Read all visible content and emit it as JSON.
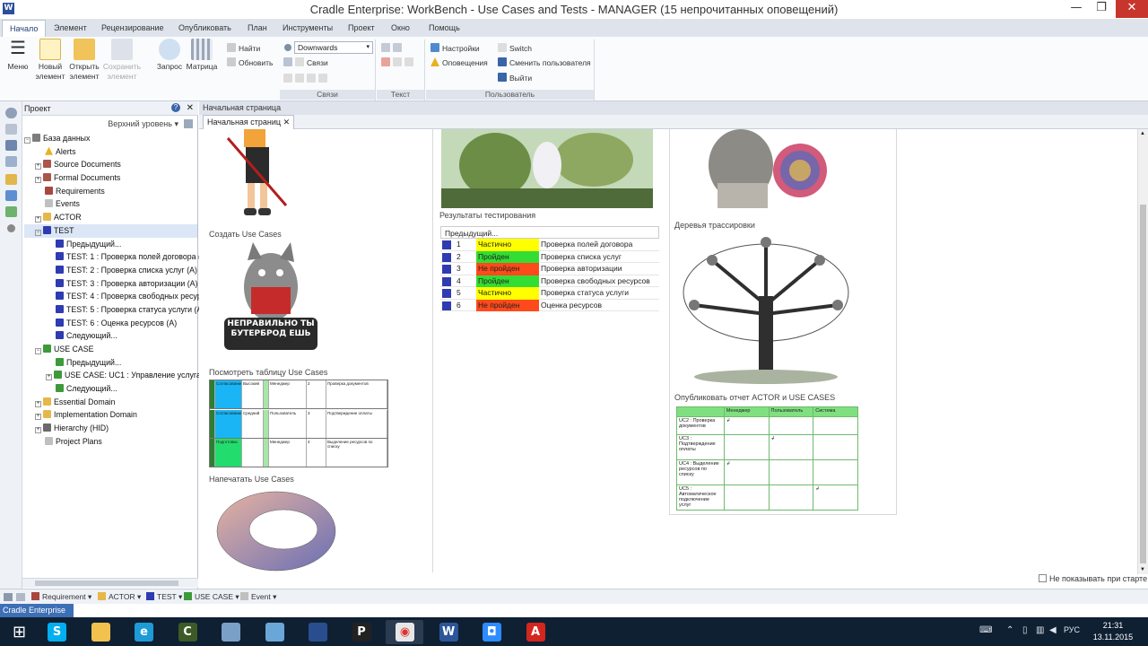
{
  "window": {
    "title": "Cradle Enterprise: WorkBench - Use Cases and Tests - MANAGER (15 непрочитанных оповещений)",
    "minimize": "—",
    "maximize": "❐",
    "close": "✕"
  },
  "menu": [
    "Начало",
    "Элемент",
    "Рецензирование",
    "Опубликовать",
    "План",
    "Инструменты",
    "Проект",
    "Окно",
    "Помощь"
  ],
  "ribbon": {
    "menu_label": "Меню",
    "new_label": "Новый элемент",
    "open_label": "Открыть элемент",
    "save_label": "Сохранить элемент",
    "query_label": "Запрос",
    "matrix_label": "Матрица",
    "find_label": "Найти",
    "refresh_label": "Обновить",
    "direction_value": "Downwards",
    "links_small": "Связи",
    "group_links": "Связи",
    "group_text": "Текст",
    "settings_label": "Настройки",
    "alerts_label": "Оповещения",
    "switch_label": "Switch",
    "change_user_label": "Сменить пользователя",
    "exit_label": "Выйти",
    "group_user": "Пользователь"
  },
  "left_panel": {
    "title": "Проект",
    "level": "Верхний уровень",
    "tree": [
      {
        "label": "База данных",
        "indent": 0,
        "icon": "ic-db",
        "exp": "−"
      },
      {
        "label": "Alerts",
        "indent": 1,
        "icon": "ic-warn",
        "exp": ""
      },
      {
        "label": "Source Documents",
        "indent": 1,
        "icon": "ic-doc",
        "exp": "+"
      },
      {
        "label": "Formal Documents",
        "indent": 1,
        "icon": "ic-doc",
        "exp": "+"
      },
      {
        "label": "Requirements",
        "indent": 1,
        "icon": "ic-req",
        "exp": ""
      },
      {
        "label": "Events",
        "indent": 1,
        "icon": "ic-plan",
        "exp": ""
      },
      {
        "label": "ACTOR",
        "indent": 1,
        "icon": "ic-folder",
        "exp": "+"
      },
      {
        "label": "TEST",
        "indent": 1,
        "icon": "ic-blue",
        "exp": "−"
      },
      {
        "label": "Предыдущий...",
        "indent": 2,
        "icon": "ic-blue",
        "exp": ""
      },
      {
        "label": "TEST: 1 : Проверка полей договора (A",
        "indent": 2,
        "icon": "ic-blue",
        "exp": ""
      },
      {
        "label": "TEST: 2 : Проверка списка услуг (A)",
        "indent": 2,
        "icon": "ic-blue",
        "exp": ""
      },
      {
        "label": "TEST: 3 : Проверка авторизации (A)",
        "indent": 2,
        "icon": "ic-blue",
        "exp": ""
      },
      {
        "label": "TEST: 4 : Проверка свободных ресурс",
        "indent": 2,
        "icon": "ic-blue",
        "exp": ""
      },
      {
        "label": "TEST: 5 : Проверка статуса услуги (A)",
        "indent": 2,
        "icon": "ic-blue",
        "exp": ""
      },
      {
        "label": "TEST: 6 : Оценка ресурсов (A)",
        "indent": 2,
        "icon": "ic-blue",
        "exp": ""
      },
      {
        "label": "Следующий...",
        "indent": 2,
        "icon": "ic-blue",
        "exp": ""
      },
      {
        "label": "USE CASE",
        "indent": 1,
        "icon": "ic-green",
        "exp": "−"
      },
      {
        "label": "Предыдущий...",
        "indent": 2,
        "icon": "ic-green",
        "exp": ""
      },
      {
        "label": "USE CASE: UC1 : Управление услугами",
        "indent": 2,
        "icon": "ic-green",
        "exp": "+"
      },
      {
        "label": "Следующий...",
        "indent": 2,
        "icon": "ic-green",
        "exp": ""
      },
      {
        "label": "Essential Domain",
        "indent": 1,
        "icon": "ic-folder",
        "exp": "+"
      },
      {
        "label": "Implementation Domain",
        "indent": 1,
        "icon": "ic-folder",
        "exp": "+"
      },
      {
        "label": "Hierarchy (HID)",
        "indent": 1,
        "icon": "ic-tree",
        "exp": "+"
      },
      {
        "label": "Project Plans",
        "indent": 1,
        "icon": "ic-plan",
        "exp": ""
      }
    ]
  },
  "doc": {
    "strip_title": "Начальная страница",
    "tab_label": "Начальная страниц",
    "captions": {
      "create": "Создать Use Cases",
      "view_table": "Посмотреть таблицу Use Cases",
      "print": "Напечатать Use Cases",
      "results": "Результаты тестирования",
      "trees": "Деревья трассировки",
      "publish": "Опубликовать отчет ACTOR и USE CASES"
    },
    "logo_text": "НЕПРАВИЛЬНО ТЫ БУТЕРБРОД ЕШЬ"
  },
  "results": {
    "header": "Предыдущий...",
    "rows": [
      {
        "num": "1",
        "status": "Частично",
        "status_color": "#ffff00",
        "name": "Проверка полей договора"
      },
      {
        "num": "2",
        "status": "Пройден",
        "status_color": "#33dd33",
        "name": "Проверка списка услуг"
      },
      {
        "num": "3",
        "status": "Не пройден",
        "status_color": "#ff4a1c",
        "name": "Проверка авторизации"
      },
      {
        "num": "4",
        "status": "Пройден",
        "status_color": "#33dd33",
        "name": "Проверка свободных ресурсов"
      },
      {
        "num": "5",
        "status": "Частично",
        "status_color": "#ffff00",
        "name": "Проверка статуса услуги"
      },
      {
        "num": "6",
        "status": "Не пройден",
        "status_color": "#ff4a1c",
        "name": "Оценка ресурсов"
      }
    ]
  },
  "matrix": {
    "headers": [
      "",
      "Менеджер",
      "Пользователь",
      "Система"
    ],
    "rows": [
      {
        "label": "UC2 : Проверка документов",
        "cells": [
          "↲",
          "",
          ""
        ]
      },
      {
        "label": "UC3 : Подтверждение оплаты",
        "cells": [
          "",
          "↲",
          ""
        ]
      },
      {
        "label": "UC4 : Выделение ресурсов по списку",
        "cells": [
          "↲",
          "",
          ""
        ]
      },
      {
        "label": "UC5 : Автоматическое подключение услуг",
        "cells": [
          "",
          "",
          "↲"
        ]
      }
    ]
  },
  "uc_table": {
    "rows": [
      {
        "a": "Согласование",
        "b": "Высокий",
        "c": "Менеджер",
        "d": "2",
        "e": "Проверка документов",
        "color": "#19b5f5"
      },
      {
        "a": "Согласование",
        "b": "Средний",
        "c": "Пользователь",
        "d": "3",
        "e": "Подтверждение оплаты",
        "color": "#19b5f5"
      },
      {
        "a": "Подготовка",
        "b": "",
        "c": "Менеджер",
        "d": "4",
        "e": "Выделение ресурсов по списку",
        "color": "#22dd6e"
      }
    ]
  },
  "bottom_bar": {
    "items": [
      "Requirement",
      "ACTOR",
      "TEST",
      "USE CASE",
      "Event"
    ],
    "dont_show": "Не показывать при старте"
  },
  "status": {
    "label": "Cradle Enterprise"
  },
  "taskbar": {
    "apps": [
      "start",
      "skype",
      "explorer",
      "ie",
      "cradle",
      "notepad",
      "notes",
      "network",
      "powerpoint",
      "chrome",
      "word",
      "zoom",
      "acrobat"
    ],
    "lang": "РУС",
    "time": "21:31",
    "date": "13.11.2015"
  }
}
